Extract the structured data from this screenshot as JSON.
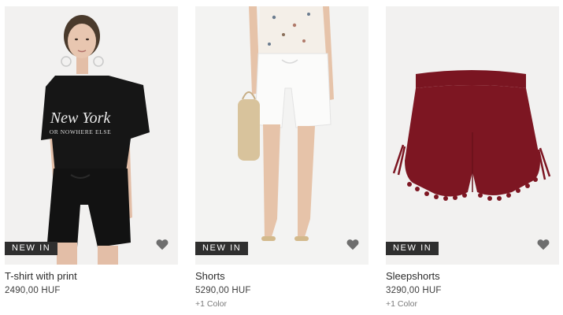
{
  "products": [
    {
      "badge": "NEW IN",
      "name": "T-shirt with print",
      "price": "2490,00 HUF",
      "colors": "",
      "tee_print": {
        "line1": "New York",
        "line2": "OR NOWHERE ELSE"
      }
    },
    {
      "badge": "NEW IN",
      "name": "Shorts",
      "price": "5290,00 HUF",
      "colors": "+1 Color"
    },
    {
      "badge": "NEW IN",
      "name": "Sleepshorts",
      "price": "3290,00 HUF",
      "colors": "+1 Color"
    }
  ],
  "icons": {
    "favorite": "heart-icon"
  },
  "theme": {
    "badge_bg": "#2f2f2f",
    "heart": "#6e6e6e",
    "burgundy": "#7d1622"
  }
}
